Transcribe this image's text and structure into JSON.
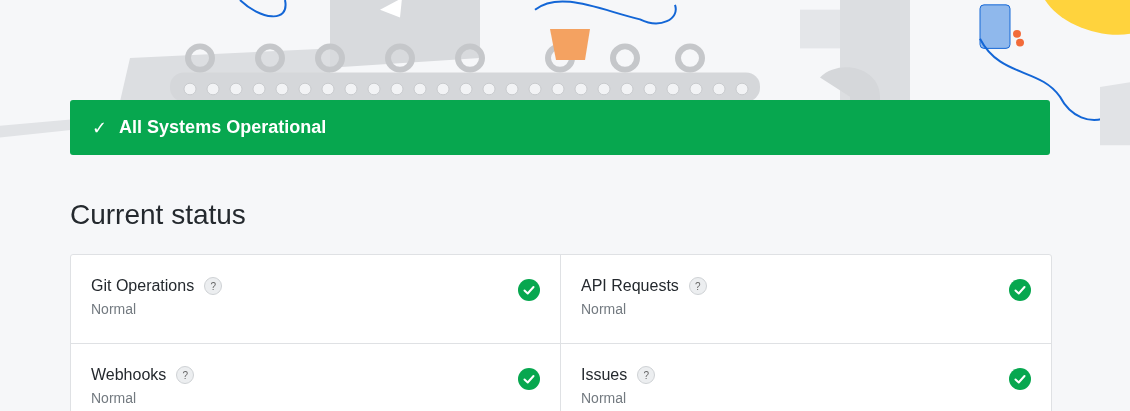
{
  "banner": {
    "operational": true,
    "check": "✓",
    "text": "All Systems Operational"
  },
  "section_title": "Current status",
  "components": [
    {
      "name": "Git Operations",
      "help": "?",
      "status_text": "Normal",
      "operational": true
    },
    {
      "name": "API Requests",
      "help": "?",
      "status_text": "Normal",
      "operational": true
    },
    {
      "name": "Webhooks",
      "help": "?",
      "status_text": "Normal",
      "operational": true
    },
    {
      "name": "Issues",
      "help": "?",
      "status_text": "Normal",
      "operational": true
    }
  ]
}
